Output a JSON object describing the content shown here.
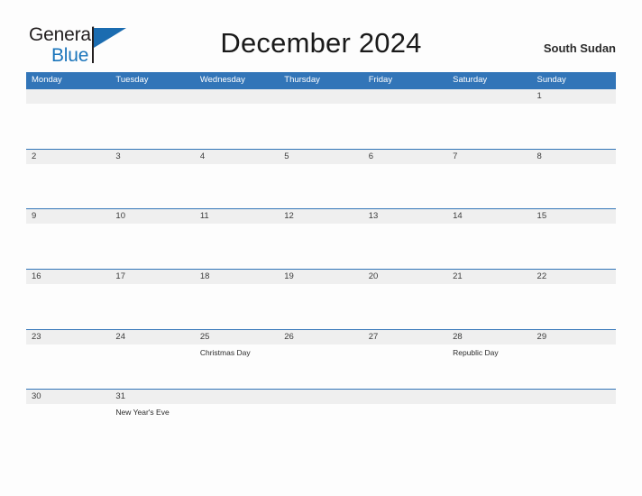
{
  "brand": {
    "name_part1": "General",
    "name_part2": "Blue",
    "flag_icon": "flag-icon"
  },
  "header": {
    "title": "December 2024",
    "locale": "South Sudan"
  },
  "calendar": {
    "weekdays": [
      "Monday",
      "Tuesday",
      "Wednesday",
      "Thursday",
      "Friday",
      "Saturday",
      "Sunday"
    ],
    "colors": {
      "header_blue": "#3275b8",
      "band_gray": "#efefef",
      "brand_blue": "#1b75bb",
      "text_dark": "#3b3b3b"
    },
    "weeks": [
      [
        {
          "date": "",
          "event": ""
        },
        {
          "date": "",
          "event": ""
        },
        {
          "date": "",
          "event": ""
        },
        {
          "date": "",
          "event": ""
        },
        {
          "date": "",
          "event": ""
        },
        {
          "date": "",
          "event": ""
        },
        {
          "date": "1",
          "event": ""
        }
      ],
      [
        {
          "date": "2",
          "event": ""
        },
        {
          "date": "3",
          "event": ""
        },
        {
          "date": "4",
          "event": ""
        },
        {
          "date": "5",
          "event": ""
        },
        {
          "date": "6",
          "event": ""
        },
        {
          "date": "7",
          "event": ""
        },
        {
          "date": "8",
          "event": ""
        }
      ],
      [
        {
          "date": "9",
          "event": ""
        },
        {
          "date": "10",
          "event": ""
        },
        {
          "date": "11",
          "event": ""
        },
        {
          "date": "12",
          "event": ""
        },
        {
          "date": "13",
          "event": ""
        },
        {
          "date": "14",
          "event": ""
        },
        {
          "date": "15",
          "event": ""
        }
      ],
      [
        {
          "date": "16",
          "event": ""
        },
        {
          "date": "17",
          "event": ""
        },
        {
          "date": "18",
          "event": ""
        },
        {
          "date": "19",
          "event": ""
        },
        {
          "date": "20",
          "event": ""
        },
        {
          "date": "21",
          "event": ""
        },
        {
          "date": "22",
          "event": ""
        }
      ],
      [
        {
          "date": "23",
          "event": ""
        },
        {
          "date": "24",
          "event": ""
        },
        {
          "date": "25",
          "event": "Christmas Day"
        },
        {
          "date": "26",
          "event": ""
        },
        {
          "date": "27",
          "event": ""
        },
        {
          "date": "28",
          "event": "Republic Day"
        },
        {
          "date": "29",
          "event": ""
        }
      ],
      [
        {
          "date": "30",
          "event": ""
        },
        {
          "date": "31",
          "event": "New Year's Eve"
        },
        {
          "date": "",
          "event": ""
        },
        {
          "date": "",
          "event": ""
        },
        {
          "date": "",
          "event": ""
        },
        {
          "date": "",
          "event": ""
        },
        {
          "date": "",
          "event": ""
        }
      ]
    ]
  }
}
